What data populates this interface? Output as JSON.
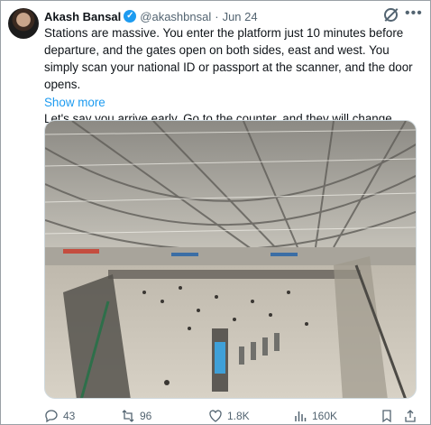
{
  "tweet": {
    "author_name": "Akash Bansal",
    "handle": "@akashbnsal",
    "separator": "·",
    "date": "Jun 24",
    "text_para_1": "Stations are massive. You enter the platform just 10 minutes before departure, and the gates open on both sides, east and west. You simply scan your national ID or passport at the scanner, and the door opens.",
    "text_para_2": "Let's say you arrive early. Go to the counter, and they will change",
    "show_more": "Show more"
  },
  "actions": {
    "replies": "43",
    "reposts": "96",
    "likes": "1.8K",
    "views": "160K"
  },
  "icons": {
    "verified": "verified-badge-icon",
    "grok": "grok-icon",
    "more": "more-icon",
    "reply": "reply-icon",
    "repost": "repost-icon",
    "like": "like-icon",
    "views": "views-icon",
    "bookmark": "bookmark-icon",
    "share": "share-icon"
  },
  "colors": {
    "accent": "#1d9bf0",
    "muted": "#536471",
    "text": "#0f1419"
  }
}
